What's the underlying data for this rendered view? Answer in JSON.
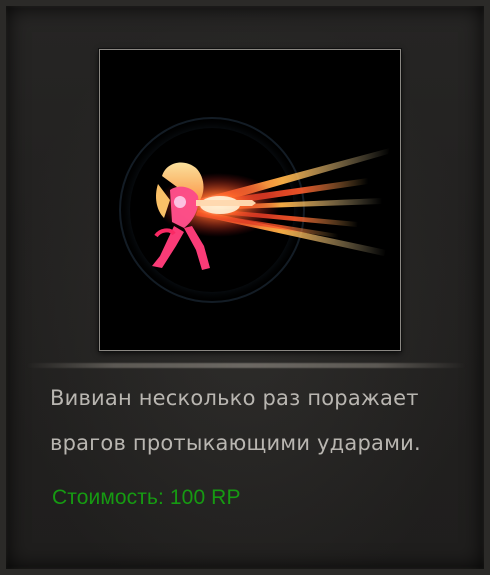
{
  "skill": {
    "icon_name": "skill-icon-piercing-strikes",
    "description": "Вивиан несколько раз поражает врагов протыкающими ударами.",
    "cost_label": "Стоимость: 100 RP"
  },
  "colors": {
    "panel_background": "#222120",
    "description_text": "#b9b6b1",
    "cost_text": "#169a12",
    "frame_border": "#8a8782"
  }
}
